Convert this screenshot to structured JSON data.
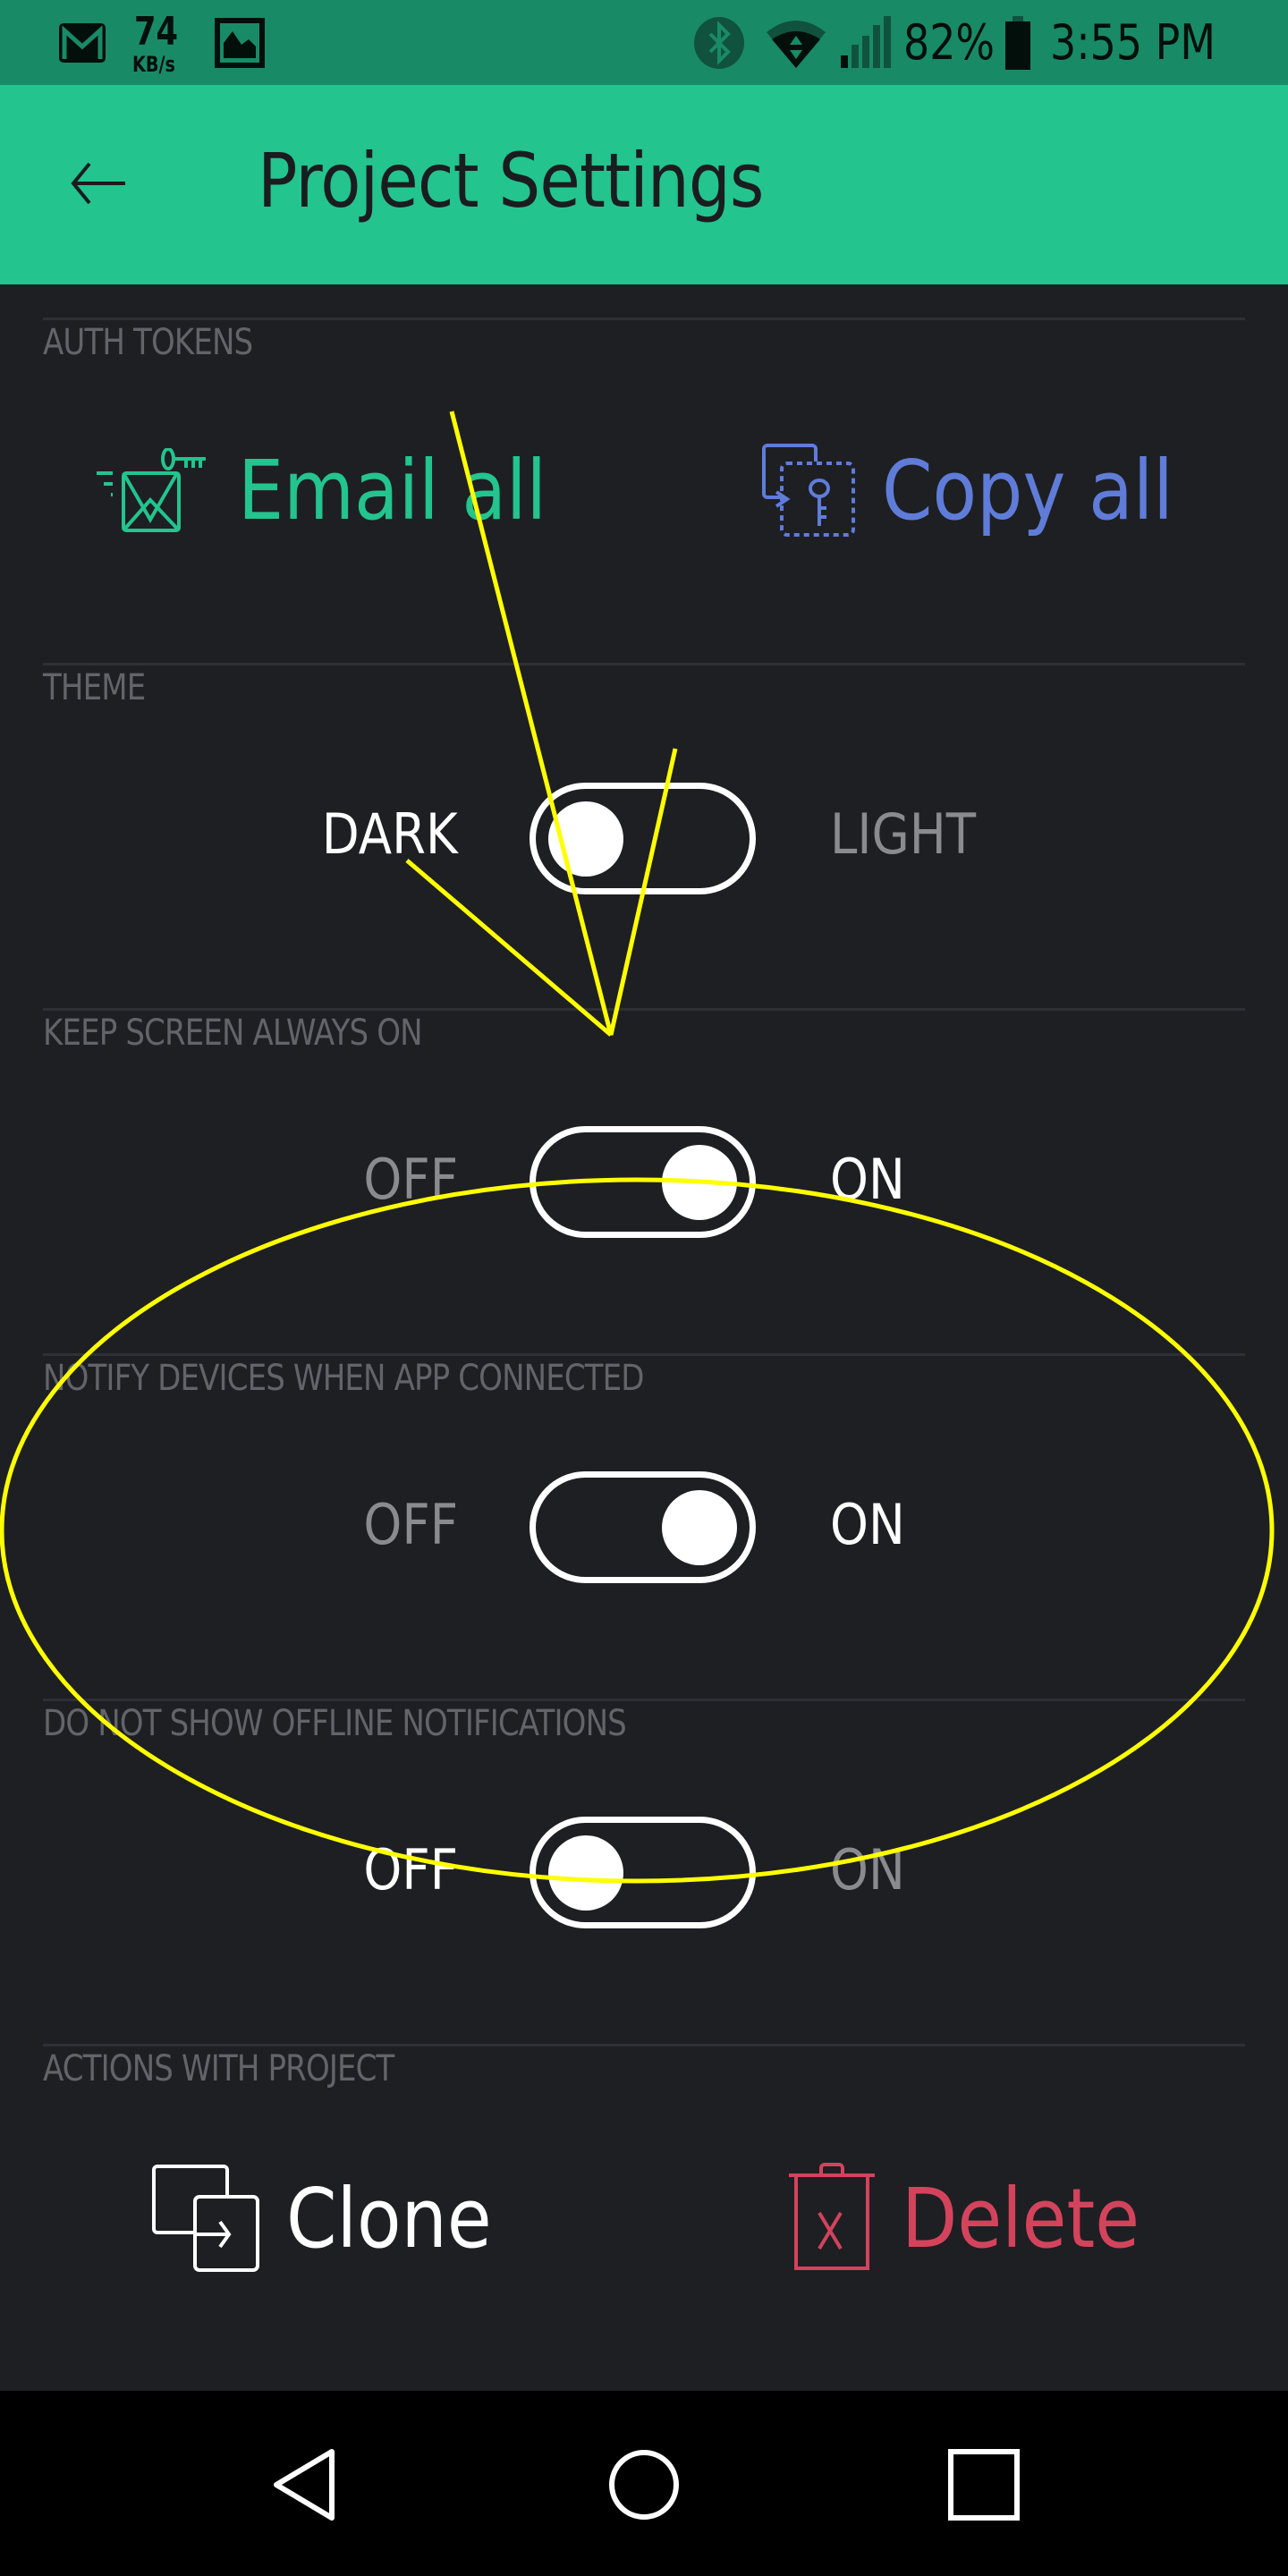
{
  "status_bar": {
    "net_speed_value": "74",
    "net_speed_unit": "KB/s",
    "battery": "82%",
    "time": "3:55 PM",
    "icons": [
      "gmail-icon",
      "gallery-icon",
      "bluetooth-icon",
      "wifi-icon",
      "signal-icon",
      "battery-icon"
    ]
  },
  "header": {
    "title": "Project Settings",
    "back_icon": "arrow-left-icon"
  },
  "sections": {
    "auth_tokens": {
      "label": "AUTH TOKENS",
      "email_all": "Email all",
      "copy_all": "Copy all"
    },
    "theme": {
      "label": "THEME",
      "left": "DARK",
      "right": "LIGHT",
      "state": "DARK"
    },
    "keep_screen": {
      "label": "KEEP SCREEN ALWAYS ON",
      "left": "OFF",
      "right": "ON",
      "state": "ON"
    },
    "notify_devices": {
      "label": "NOTIFY DEVICES WHEN APP CONNECTED",
      "left": "OFF",
      "right": "ON",
      "state": "ON"
    },
    "offline_notifications": {
      "label": "DO NOT SHOW OFFLINE NOTIFICATIONS",
      "left": "OFF",
      "right": "ON",
      "state": "OFF"
    },
    "actions": {
      "label": "ACTIONS WITH PROJECT",
      "clone": "Clone",
      "delete": "Delete"
    }
  },
  "colors": {
    "status_bar": "#198a66",
    "header": "#23c48e",
    "background": "#1e1f23",
    "email_green": "#23c48e",
    "copy_blue": "#5f7cd8",
    "delete_red": "#d3435c",
    "annotation_yellow": "#ffff00"
  },
  "nav_bar": {
    "buttons": [
      "back",
      "home",
      "recents"
    ]
  }
}
